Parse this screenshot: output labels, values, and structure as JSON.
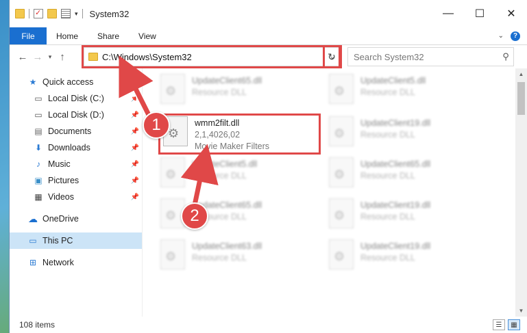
{
  "window": {
    "title": "System32",
    "controls": {
      "minimize": "—",
      "maximize": "☐",
      "close": "✕"
    }
  },
  "ribbon": {
    "tabs": [
      "File",
      "Home",
      "Share",
      "View"
    ],
    "help_icon": "?"
  },
  "address_bar": {
    "path": "C:\\Windows\\System32",
    "search_placeholder": "Search System32"
  },
  "sidebar": {
    "quick_access": "Quick access",
    "items": [
      {
        "label": "Local Disk (C:)",
        "icon": "drive-icon",
        "pinned": true
      },
      {
        "label": "Local Disk (D:)",
        "icon": "drive-icon",
        "pinned": true
      },
      {
        "label": "Documents",
        "icon": "documents-icon",
        "pinned": true
      },
      {
        "label": "Downloads",
        "icon": "download-icon",
        "pinned": true
      },
      {
        "label": "Music",
        "icon": "music-icon",
        "pinned": true
      },
      {
        "label": "Pictures",
        "icon": "pictures-icon",
        "pinned": true
      },
      {
        "label": "Videos",
        "icon": "videos-icon",
        "pinned": true
      }
    ],
    "onedrive": "OneDrive",
    "this_pc": "This PC",
    "network": "Network"
  },
  "files": [
    {
      "name": "UpdateClient65.dll",
      "type": "Resource DLL"
    },
    {
      "name": "UpdateClient5.dll",
      "type": "Resource DLL"
    },
    {
      "name": "wmm2filt.dll",
      "type": "2,1,4026,02",
      "description": "Movie Maker Filters"
    },
    {
      "name": "UpdateClient19.dll",
      "type": "Resource DLL"
    },
    {
      "name": "UpdateClient5.dll",
      "type": "Resource DLL"
    },
    {
      "name": "UpdateClient65.dll",
      "type": "Resource DLL"
    },
    {
      "name": "UpdateClient65.dll",
      "type": "Resource DLL"
    },
    {
      "name": "UpdateClient19.dll",
      "type": "Resource DLL"
    },
    {
      "name": "UpdateClient63.dll",
      "type": "Resource DLL"
    },
    {
      "name": "UpdateClient19.dll",
      "type": "Resource DLL"
    }
  ],
  "status": {
    "item_count": "108 items"
  },
  "annotations": {
    "step1": "1",
    "step2": "2",
    "color": "#e04848"
  }
}
